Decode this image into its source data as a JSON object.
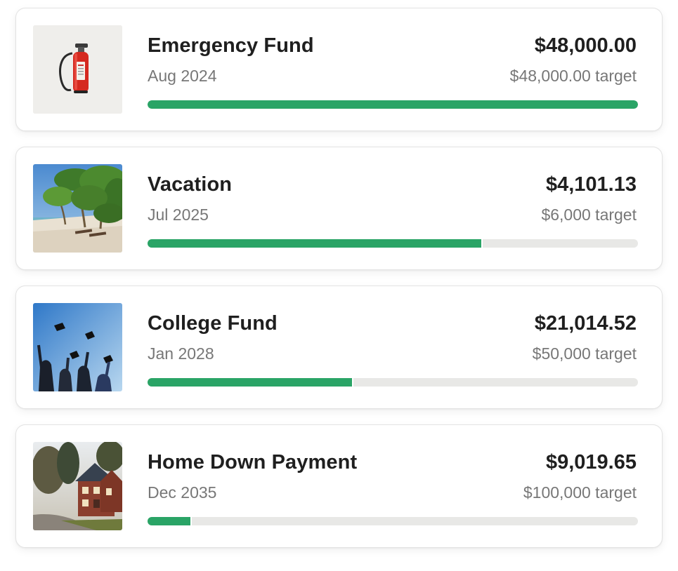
{
  "goals": [
    {
      "name": "Emergency Fund",
      "date": "Aug 2024",
      "amount": "$48,000.00",
      "target": "$48,000.00 target",
      "progress": 1.0,
      "image": "fire-extinguisher-image"
    },
    {
      "name": "Vacation",
      "date": "Jul 2025",
      "amount": "$4,101.13",
      "target": "$6,000 target",
      "progress": 0.6835,
      "image": "beach-palm-trees-image"
    },
    {
      "name": "College Fund",
      "date": "Jan 2028",
      "amount": "$21,014.52",
      "target": "$50,000 target",
      "progress": 0.4203,
      "image": "graduation-caps-image"
    },
    {
      "name": "Home Down Payment",
      "date": "Dec 2035",
      "amount": "$9,019.65",
      "target": "$100,000 target",
      "progress": 0.0902,
      "image": "house-image"
    }
  ],
  "colors": {
    "progress_fill": "#2aa466",
    "progress_track": "#e8e8e6",
    "text_primary": "#1f1f1f",
    "text_secondary": "#777777"
  }
}
